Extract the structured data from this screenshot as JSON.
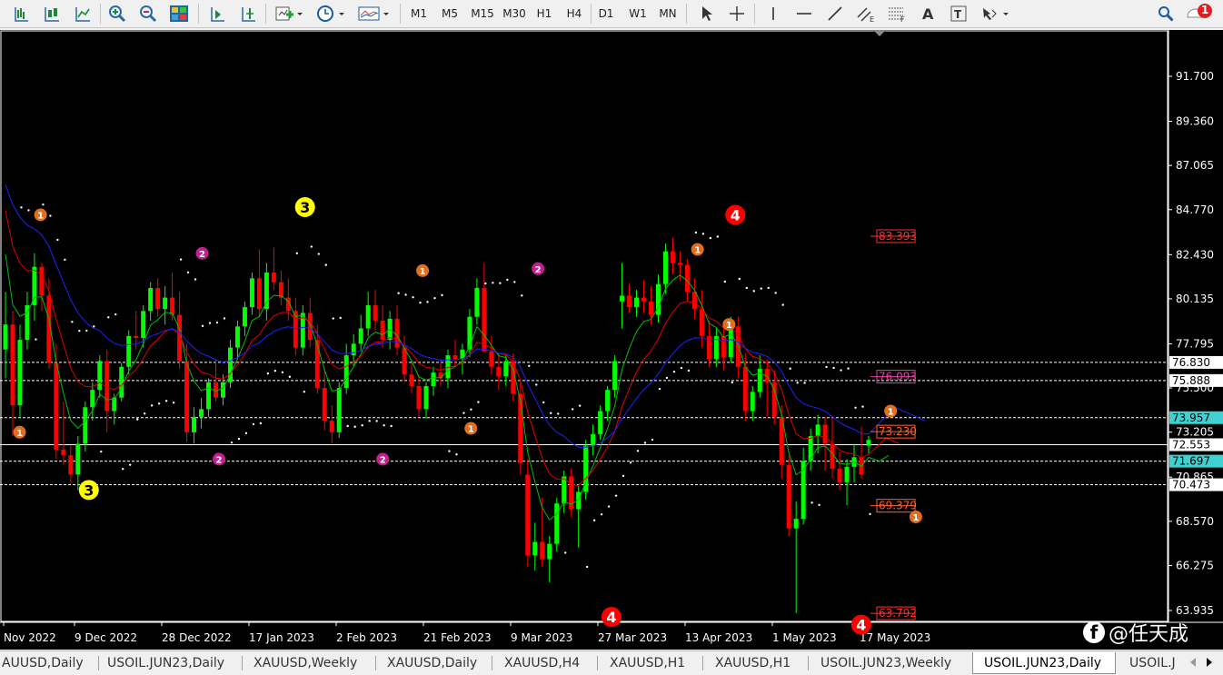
{
  "toolbar": {
    "timeframes": [
      "M1",
      "M5",
      "M15",
      "M30",
      "H1",
      "H4",
      "D1",
      "W1",
      "MN"
    ],
    "notification_count": "1"
  },
  "chart": {
    "background": "#000000",
    "bull_color": "#00ff00",
    "bear_color": "#ff0000",
    "axis_price_labels": [
      "91.700",
      "89.360",
      "87.065",
      "84.770",
      "82.430",
      "80.135",
      "77.795",
      "75.500",
      "73.205",
      "70.865",
      "68.570",
      "66.275",
      "63.935"
    ],
    "date_labels": [
      "Nov 2022",
      "9 Dec 2022",
      "28 Dec 2022",
      "17 Jan 2023",
      "2 Feb 2023",
      "21 Feb 2023",
      "9 Mar 2023",
      "27 Mar 2023",
      "13 Apr 2023",
      "1 May 2023",
      "17 May 2023"
    ],
    "horizontal_levels": [
      {
        "price": "76.830",
        "style": "dashed",
        "box": "#ffffff",
        "text_color": "#000000"
      },
      {
        "price": "75.888",
        "style": "dashed",
        "box": "#ffffff",
        "text_color": "#000000"
      },
      {
        "price": "73.957",
        "style": "dashed",
        "box": "#40d0d0",
        "text_color": "#000000"
      },
      {
        "price": "72.553",
        "style": "solid",
        "box": "#ffffff",
        "text_color": "#000000"
      },
      {
        "price": "71.697",
        "style": "dashed",
        "box": "#40d0d0",
        "text_color": "#000000"
      },
      {
        "price": "70.473",
        "style": "dashed",
        "box": "#ffffff",
        "text_color": "#000000"
      }
    ],
    "fib_labels": [
      {
        "text": "83.393",
        "color": "#ff3030",
        "price": 83.39
      },
      {
        "text": "76.093",
        "color": "#e040a0",
        "price": 76.09
      },
      {
        "text": "73.230",
        "color": "#ff6030",
        "price": 73.23
      },
      {
        "text": "69.379",
        "color": "#ff6030",
        "price": 69.38
      },
      {
        "text": "63.792",
        "color": "#ff3030",
        "price": 63.79
      }
    ],
    "wave_markers": [
      {
        "label": "1",
        "color": "#e07020",
        "size": "small",
        "date_index": 0.5,
        "price": 73.2
      },
      {
        "label": "1",
        "color": "#e07020",
        "size": "small",
        "date_index": 1.5,
        "price": 84.5
      },
      {
        "label": "3",
        "color": "#ffff00",
        "size": "big",
        "date_index": 3.8,
        "price": 70.2
      },
      {
        "label": "2",
        "color": "#c02090",
        "size": "small",
        "date_index": 9.2,
        "price": 82.5
      },
      {
        "label": "2",
        "color": "#c02090",
        "size": "small",
        "date_index": 10.0,
        "price": 71.8
      },
      {
        "label": "3",
        "color": "#ffff00",
        "size": "big",
        "date_index": 14.1,
        "price": 84.9
      },
      {
        "label": "2",
        "color": "#c02090",
        "size": "small",
        "date_index": 17.8,
        "price": 71.8
      },
      {
        "label": "1",
        "color": "#e07020",
        "size": "small",
        "date_index": 19.7,
        "price": 81.6
      },
      {
        "label": "1",
        "color": "#e07020",
        "size": "small",
        "date_index": 22.0,
        "price": 73.4
      },
      {
        "label": "2",
        "color": "#c02090",
        "size": "small",
        "date_index": 25.2,
        "price": 81.7
      },
      {
        "label": "4",
        "color": "#ff0000",
        "size": "big",
        "date_index": 28.7,
        "price": 63.6
      },
      {
        "label": "1",
        "color": "#e07020",
        "size": "small",
        "date_index": 32.8,
        "price": 82.7
      },
      {
        "label": "1",
        "color": "#e07020",
        "size": "small",
        "date_index": 34.3,
        "price": 78.8
      },
      {
        "label": "4",
        "color": "#ff0000",
        "size": "big",
        "date_index": 34.6,
        "price": 84.5
      },
      {
        "label": "4",
        "color": "#ff0000",
        "size": "big",
        "date_index": 40.6,
        "price": 63.2
      },
      {
        "label": "1",
        "color": "#e07020",
        "size": "small",
        "date_index": 42.0,
        "price": 74.3
      },
      {
        "label": "1",
        "color": "#e07020",
        "size": "small",
        "date_index": 43.2,
        "price": 68.8
      }
    ],
    "candles": [
      [
        77.5,
        80.5,
        76.0,
        78.8
      ],
      [
        78.8,
        79.5,
        73.0,
        74.6
      ],
      [
        74.6,
        78.8,
        74.0,
        78.0
      ],
      [
        78.0,
        80.5,
        77.5,
        79.8
      ],
      [
        79.8,
        82.5,
        79.0,
        81.8
      ],
      [
        81.8,
        82.0,
        79.5,
        80.3
      ],
      [
        80.3,
        81.2,
        76.5,
        76.8
      ],
      [
        76.8,
        77.8,
        71.8,
        72.3
      ],
      [
        72.3,
        74.8,
        71.5,
        72.0
      ],
      [
        72.0,
        72.5,
        70.5,
        71.0
      ],
      [
        71.0,
        73.0,
        70.2,
        72.6
      ],
      [
        72.6,
        74.8,
        72.2,
        74.5
      ],
      [
        74.5,
        75.8,
        73.8,
        75.4
      ],
      [
        75.4,
        77.2,
        75.0,
        76.9
      ],
      [
        76.9,
        77.5,
        73.2,
        74.3
      ],
      [
        74.3,
        75.2,
        73.6,
        75.0
      ],
      [
        75.0,
        76.8,
        74.8,
        76.6
      ],
      [
        76.6,
        78.5,
        76.2,
        78.2
      ],
      [
        78.2,
        79.5,
        77.5,
        78.1
      ],
      [
        78.1,
        79.8,
        77.6,
        79.5
      ],
      [
        79.5,
        81.0,
        79.0,
        80.7
      ],
      [
        80.7,
        81.2,
        79.2,
        79.6
      ],
      [
        79.6,
        80.8,
        78.8,
        80.2
      ],
      [
        80.2,
        81.5,
        79.0,
        79.3
      ],
      [
        79.3,
        80.5,
        76.5,
        76.9
      ],
      [
        76.9,
        77.8,
        72.7,
        73.2
      ],
      [
        73.2,
        74.5,
        72.6,
        74.0
      ],
      [
        74.0,
        75.0,
        73.4,
        74.4
      ],
      [
        74.4,
        76.0,
        74.0,
        75.8
      ],
      [
        75.8,
        77.0,
        74.8,
        75.0
      ],
      [
        75.0,
        76.2,
        74.6,
        75.8
      ],
      [
        75.8,
        78.0,
        75.5,
        77.6
      ],
      [
        77.6,
        79.0,
        77.0,
        78.7
      ],
      [
        78.7,
        80.0,
        78.2,
        79.7
      ],
      [
        79.7,
        81.5,
        79.3,
        81.2
      ],
      [
        81.2,
        82.7,
        79.2,
        79.6
      ],
      [
        79.6,
        82.0,
        79.0,
        81.5
      ],
      [
        81.5,
        82.8,
        80.6,
        81.0
      ],
      [
        81.0,
        81.6,
        79.8,
        80.2
      ],
      [
        80.2,
        81.2,
        79.0,
        79.5
      ],
      [
        79.5,
        80.2,
        77.2,
        77.6
      ],
      [
        77.6,
        79.8,
        77.2,
        79.4
      ],
      [
        79.4,
        80.2,
        77.6,
        78.0
      ],
      [
        78.0,
        78.8,
        75.2,
        75.5
      ],
      [
        75.5,
        76.5,
        73.3,
        73.8
      ],
      [
        73.8,
        74.6,
        72.6,
        73.2
      ],
      [
        73.2,
        75.8,
        72.9,
        75.5
      ],
      [
        75.5,
        77.8,
        75.2,
        77.2
      ],
      [
        77.2,
        78.3,
        76.6,
        77.8
      ],
      [
        77.8,
        79.3,
        77.4,
        78.6
      ],
      [
        78.6,
        80.5,
        78.2,
        79.8
      ],
      [
        79.8,
        80.6,
        78.5,
        79.0
      ],
      [
        79.0,
        79.8,
        77.6,
        78.0
      ],
      [
        78.0,
        79.5,
        77.5,
        79.1
      ],
      [
        79.1,
        79.8,
        77.2,
        77.6
      ],
      [
        77.6,
        78.2,
        75.8,
        76.2
      ],
      [
        76.2,
        76.8,
        75.2,
        75.6
      ],
      [
        75.6,
        76.2,
        74.0,
        74.4
      ],
      [
        74.4,
        75.8,
        73.9,
        75.6
      ],
      [
        75.6,
        76.6,
        75.1,
        76.3
      ],
      [
        76.3,
        77.0,
        75.6,
        76.0
      ],
      [
        76.0,
        77.5,
        75.5,
        77.2
      ],
      [
        77.2,
        78.0,
        76.6,
        77.0
      ],
      [
        77.0,
        77.8,
        76.2,
        77.5
      ],
      [
        77.5,
        79.6,
        77.1,
        79.2
      ],
      [
        79.2,
        81.2,
        78.8,
        80.7
      ],
      [
        80.7,
        82.0,
        79.2,
        77.4
      ],
      [
        77.4,
        78.2,
        76.2,
        76.6
      ],
      [
        76.6,
        77.3,
        75.4,
        76.1
      ],
      [
        76.1,
        77.2,
        75.6,
        76.9
      ],
      [
        76.9,
        77.3,
        74.8,
        75.2
      ],
      [
        75.2,
        75.8,
        71.0,
        71.6
      ],
      [
        71.0,
        71.8,
        66.2,
        66.8
      ],
      [
        66.8,
        68.5,
        66.0,
        67.5
      ],
      [
        67.5,
        69.8,
        66.2,
        66.6
      ],
      [
        66.6,
        67.8,
        65.4,
        67.4
      ],
      [
        67.4,
        69.8,
        67.0,
        69.5
      ],
      [
        69.5,
        71.2,
        69.0,
        70.9
      ],
      [
        70.9,
        71.3,
        68.8,
        69.2
      ],
      [
        69.2,
        70.5,
        67.2,
        70.1
      ],
      [
        70.1,
        72.8,
        69.7,
        72.5
      ],
      [
        72.5,
        73.6,
        72.0,
        73.1
      ],
      [
        73.1,
        74.6,
        72.8,
        74.3
      ],
      [
        74.3,
        75.6,
        73.8,
        75.4
      ],
      [
        75.4,
        77.2,
        75.0,
        76.9
      ],
      [
        80.0,
        82.0,
        78.6,
        80.3
      ],
      [
        80.3,
        80.9,
        79.4,
        79.7
      ],
      [
        79.7,
        80.6,
        79.2,
        80.2
      ],
      [
        80.2,
        81.1,
        79.4,
        80.0
      ],
      [
        80.0,
        80.8,
        78.8,
        79.3
      ],
      [
        79.3,
        81.4,
        78.9,
        80.9
      ],
      [
        80.9,
        83.0,
        80.4,
        82.6
      ],
      [
        82.6,
        83.3,
        81.4,
        82.0
      ],
      [
        82.0,
        82.6,
        81.1,
        81.9
      ],
      [
        81.9,
        82.2,
        80.0,
        80.5
      ],
      [
        80.5,
        81.2,
        79.1,
        79.6
      ],
      [
        79.6,
        80.6,
        77.6,
        78.2
      ],
      [
        78.2,
        79.0,
        76.6,
        77.0
      ],
      [
        77.0,
        78.6,
        76.6,
        78.2
      ],
      [
        78.2,
        79.0,
        76.4,
        77.1
      ],
      [
        77.1,
        79.2,
        76.8,
        78.7
      ],
      [
        78.7,
        79.2,
        76.0,
        76.6
      ],
      [
        76.6,
        77.3,
        73.8,
        74.3
      ],
      [
        74.3,
        75.6,
        73.8,
        75.3
      ],
      [
        75.3,
        77.2,
        75.0,
        76.5
      ],
      [
        76.5,
        77.0,
        74.0,
        75.8
      ],
      [
        75.8,
        76.4,
        73.6,
        74.0
      ],
      [
        74.0,
        74.6,
        70.8,
        71.5
      ],
      [
        71.5,
        72.0,
        67.8,
        68.2
      ],
      [
        68.2,
        69.6,
        63.8,
        68.7
      ],
      [
        68.7,
        72.4,
        68.4,
        71.7
      ],
      [
        71.7,
        73.4,
        71.2,
        73.0
      ],
      [
        73.0,
        74.1,
        72.1,
        73.6
      ],
      [
        73.6,
        74.0,
        71.2,
        72.6
      ],
      [
        72.6,
        74.0,
        70.8,
        71.3
      ],
      [
        71.3,
        72.2,
        70.2,
        70.6
      ],
      [
        70.6,
        71.8,
        69.4,
        71.4
      ],
      [
        71.4,
        72.6,
        70.6,
        71.9
      ],
      [
        71.9,
        73.5,
        70.8,
        71.0
      ],
      [
        72.5,
        73.0,
        72.1,
        72.8
      ]
    ]
  },
  "tabs": [
    "AUUSD,Daily",
    "USOIL.JUN23,Daily",
    "XAUUSD,Weekly",
    "XAUUSD,Daily",
    "XAUUSD,H4",
    "XAUUSD,H1",
    "XAUUSD,H1",
    "USOIL.JUN23,Weekly",
    "USOIL.JUN23,Daily",
    "USOIL.J"
  ],
  "active_tab_index": 8,
  "watermark": {
    "icon_letter": "f",
    "text": "@任天成"
  }
}
